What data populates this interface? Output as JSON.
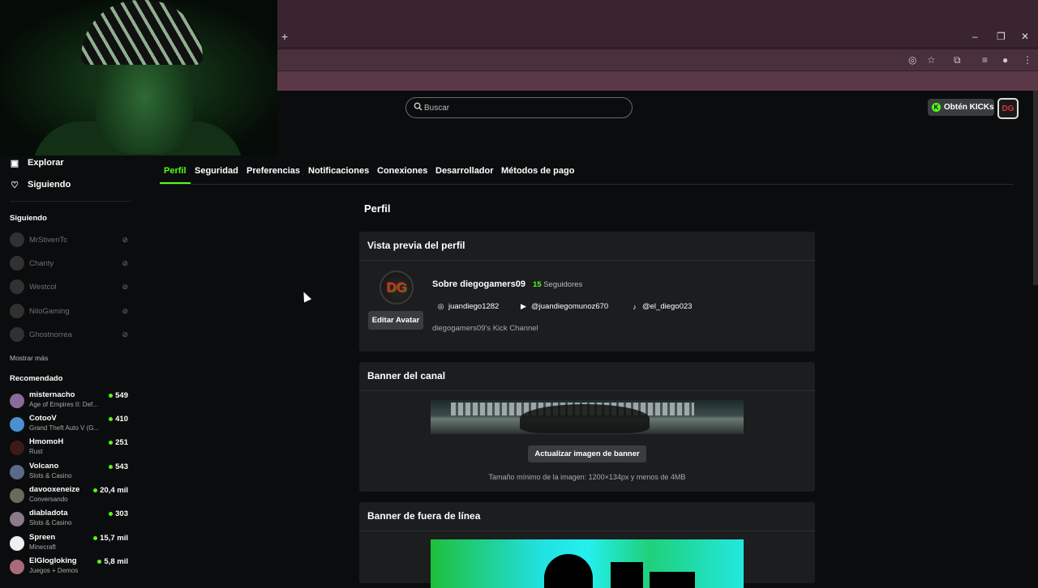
{
  "browser": {
    "new_tab_glyph": "+",
    "window_controls": [
      "–",
      "❐",
      "✕"
    ]
  },
  "header": {
    "search_placeholder": "Buscar",
    "kicks_label": "Obtén KICKs",
    "avatar_initials": "DG"
  },
  "sidebar": {
    "nav": [
      {
        "label": "Explorar",
        "icon": "explore-icon"
      },
      {
        "label": "Siguiendo",
        "icon": "heart-icon"
      }
    ],
    "following_heading": "Siguiendo",
    "following": [
      {
        "name": "MrStivenTc"
      },
      {
        "name": "Chanty"
      },
      {
        "name": "Westcol"
      },
      {
        "name": "NiloGaming"
      },
      {
        "name": "Ghostnorrea"
      }
    ],
    "show_more": "Mostrar más",
    "recommended_heading": "Recomendado",
    "recommended": [
      {
        "name": "misternacho",
        "category": "Age of Empires II: Def...",
        "viewers": "549",
        "color": "#8a6a9a"
      },
      {
        "name": "CotooV",
        "category": "Grand Theft Auto V (G...",
        "viewers": "410",
        "color": "#4a8fd0"
      },
      {
        "name": "HmomoH",
        "category": "Rust",
        "viewers": "251",
        "color": "#3a1a1a"
      },
      {
        "name": "Volcano",
        "category": "Slots & Casino",
        "viewers": "543",
        "color": "#5a6a8a"
      },
      {
        "name": "davooxeneize",
        "category": "Conversando",
        "viewers": "20,4 mil",
        "color": "#6a6a5a"
      },
      {
        "name": "diabladota",
        "category": "Slots & Casino",
        "viewers": "303",
        "color": "#8a7a8a"
      },
      {
        "name": "Spreen",
        "category": "Minecraft",
        "viewers": "15,7 mil",
        "color": "#f0f0f0"
      },
      {
        "name": "ElGlogloking",
        "category": "Juegos + Demos",
        "viewers": "5,8 mil",
        "color": "#aa6a7a"
      }
    ]
  },
  "tabs": [
    "Perfil",
    "Seguridad",
    "Preferencias",
    "Notificaciones",
    "Conexiones",
    "Desarrollador",
    "Métodos de pago"
  ],
  "page_title": "Perfil",
  "profile_preview": {
    "title": "Vista previa del perfil",
    "avatar_initials": "DG",
    "edit_avatar": "Editar Avatar",
    "about": "Sobre diegogamers09",
    "followers_count": "15",
    "followers_label": "Seguidores",
    "instagram": "juandiego1282",
    "youtube": "@juandiegomunoz670",
    "tiktok": "@el_diego023",
    "description": "diegogamers09's Kick Channel"
  },
  "channel_banner": {
    "title": "Banner del canal",
    "update_button": "Actualizar imagen de banner",
    "hint": "Tamaño mínimo de la imagen: 1200×134px y menos de 4MB"
  },
  "offline_banner": {
    "title": "Banner de fuera de línea"
  },
  "colors": {
    "accent": "#53fc18",
    "background": "#0b0c0d",
    "card": "#1b1d1f",
    "tab_strip": "#3a2430"
  }
}
